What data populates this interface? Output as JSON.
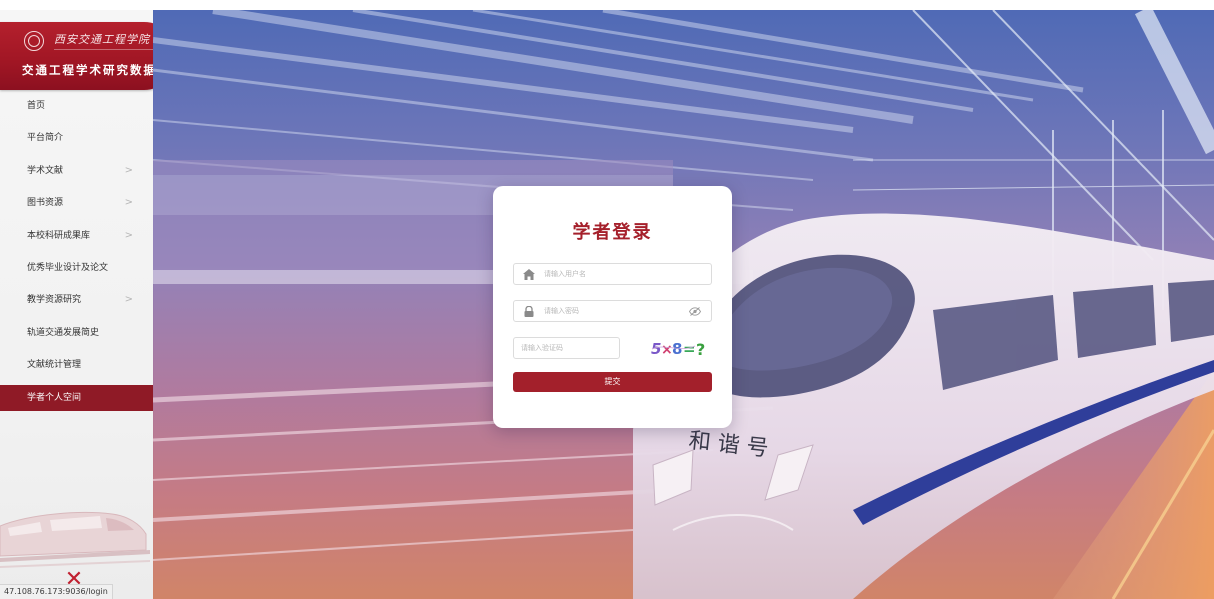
{
  "sidebar": {
    "logo": {
      "script_text": "西安交通工程学院",
      "title": "交通工程学术研究数据库"
    },
    "items": [
      {
        "label": "首页",
        "has_arrow": false
      },
      {
        "label": "平台简介",
        "has_arrow": false
      },
      {
        "label": "学术文献",
        "has_arrow": true
      },
      {
        "label": "图书资源",
        "has_arrow": true
      },
      {
        "label": "本校科研成果库",
        "has_arrow": true
      },
      {
        "label": "优秀毕业设计及论文",
        "has_arrow": false
      },
      {
        "label": "教学资源研究",
        "has_arrow": true
      },
      {
        "label": "轨道交通发展简史",
        "has_arrow": false
      },
      {
        "label": "文献统计管理",
        "has_arrow": false
      },
      {
        "label": "学者个人空间",
        "has_arrow": false,
        "active": true
      }
    ],
    "arrow_glyph": ">",
    "close_glyph": "✕"
  },
  "status_bar": {
    "url": "47.108.76.173:9036/login"
  },
  "hero": {
    "train_text": "和 谐 号"
  },
  "login": {
    "title": "学者登录",
    "username_placeholder": "请输入用户名",
    "password_placeholder": "请输入密码",
    "captcha_placeholder": "请输入验证码",
    "captcha_text": "5×8=?",
    "submit_label": "提交",
    "icons": {
      "username": "home-icon",
      "password": "lock-icon",
      "toggle": "eye-icon"
    }
  },
  "colors": {
    "brand_red": "#a3202b",
    "active_nav": "#8f1a26",
    "hero_top": "#4662b2",
    "hero_bottom": "#ce7e60"
  }
}
